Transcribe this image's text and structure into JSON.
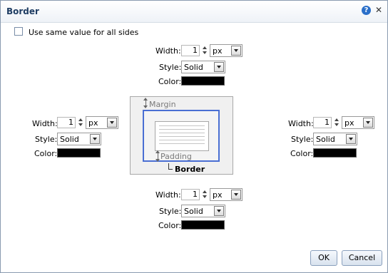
{
  "dialog": {
    "title": "Border",
    "help_icon": "help-icon",
    "close_icon": "close-icon",
    "help_symbol": "?",
    "close_symbol": "✕"
  },
  "same_value": {
    "label": "Use same value for all sides",
    "checked": false
  },
  "labels": {
    "width": "Width:",
    "style": "Style:",
    "color": "Color:"
  },
  "sides": {
    "top": {
      "width": "1",
      "unit": "px",
      "style": "Solid",
      "color": "#000000"
    },
    "left": {
      "width": "1",
      "unit": "px",
      "style": "Solid",
      "color": "#000000"
    },
    "right": {
      "width": "1",
      "unit": "px",
      "style": "Solid",
      "color": "#000000"
    },
    "bottom": {
      "width": "1",
      "unit": "px",
      "style": "Solid",
      "color": "#000000"
    }
  },
  "diagram": {
    "margin": "Margin",
    "padding": "Padding",
    "border": "Border"
  },
  "buttons": {
    "ok": "OK",
    "cancel": "Cancel"
  },
  "colors": {
    "accent": "#4a6fd3",
    "title": "#1f3d63"
  }
}
